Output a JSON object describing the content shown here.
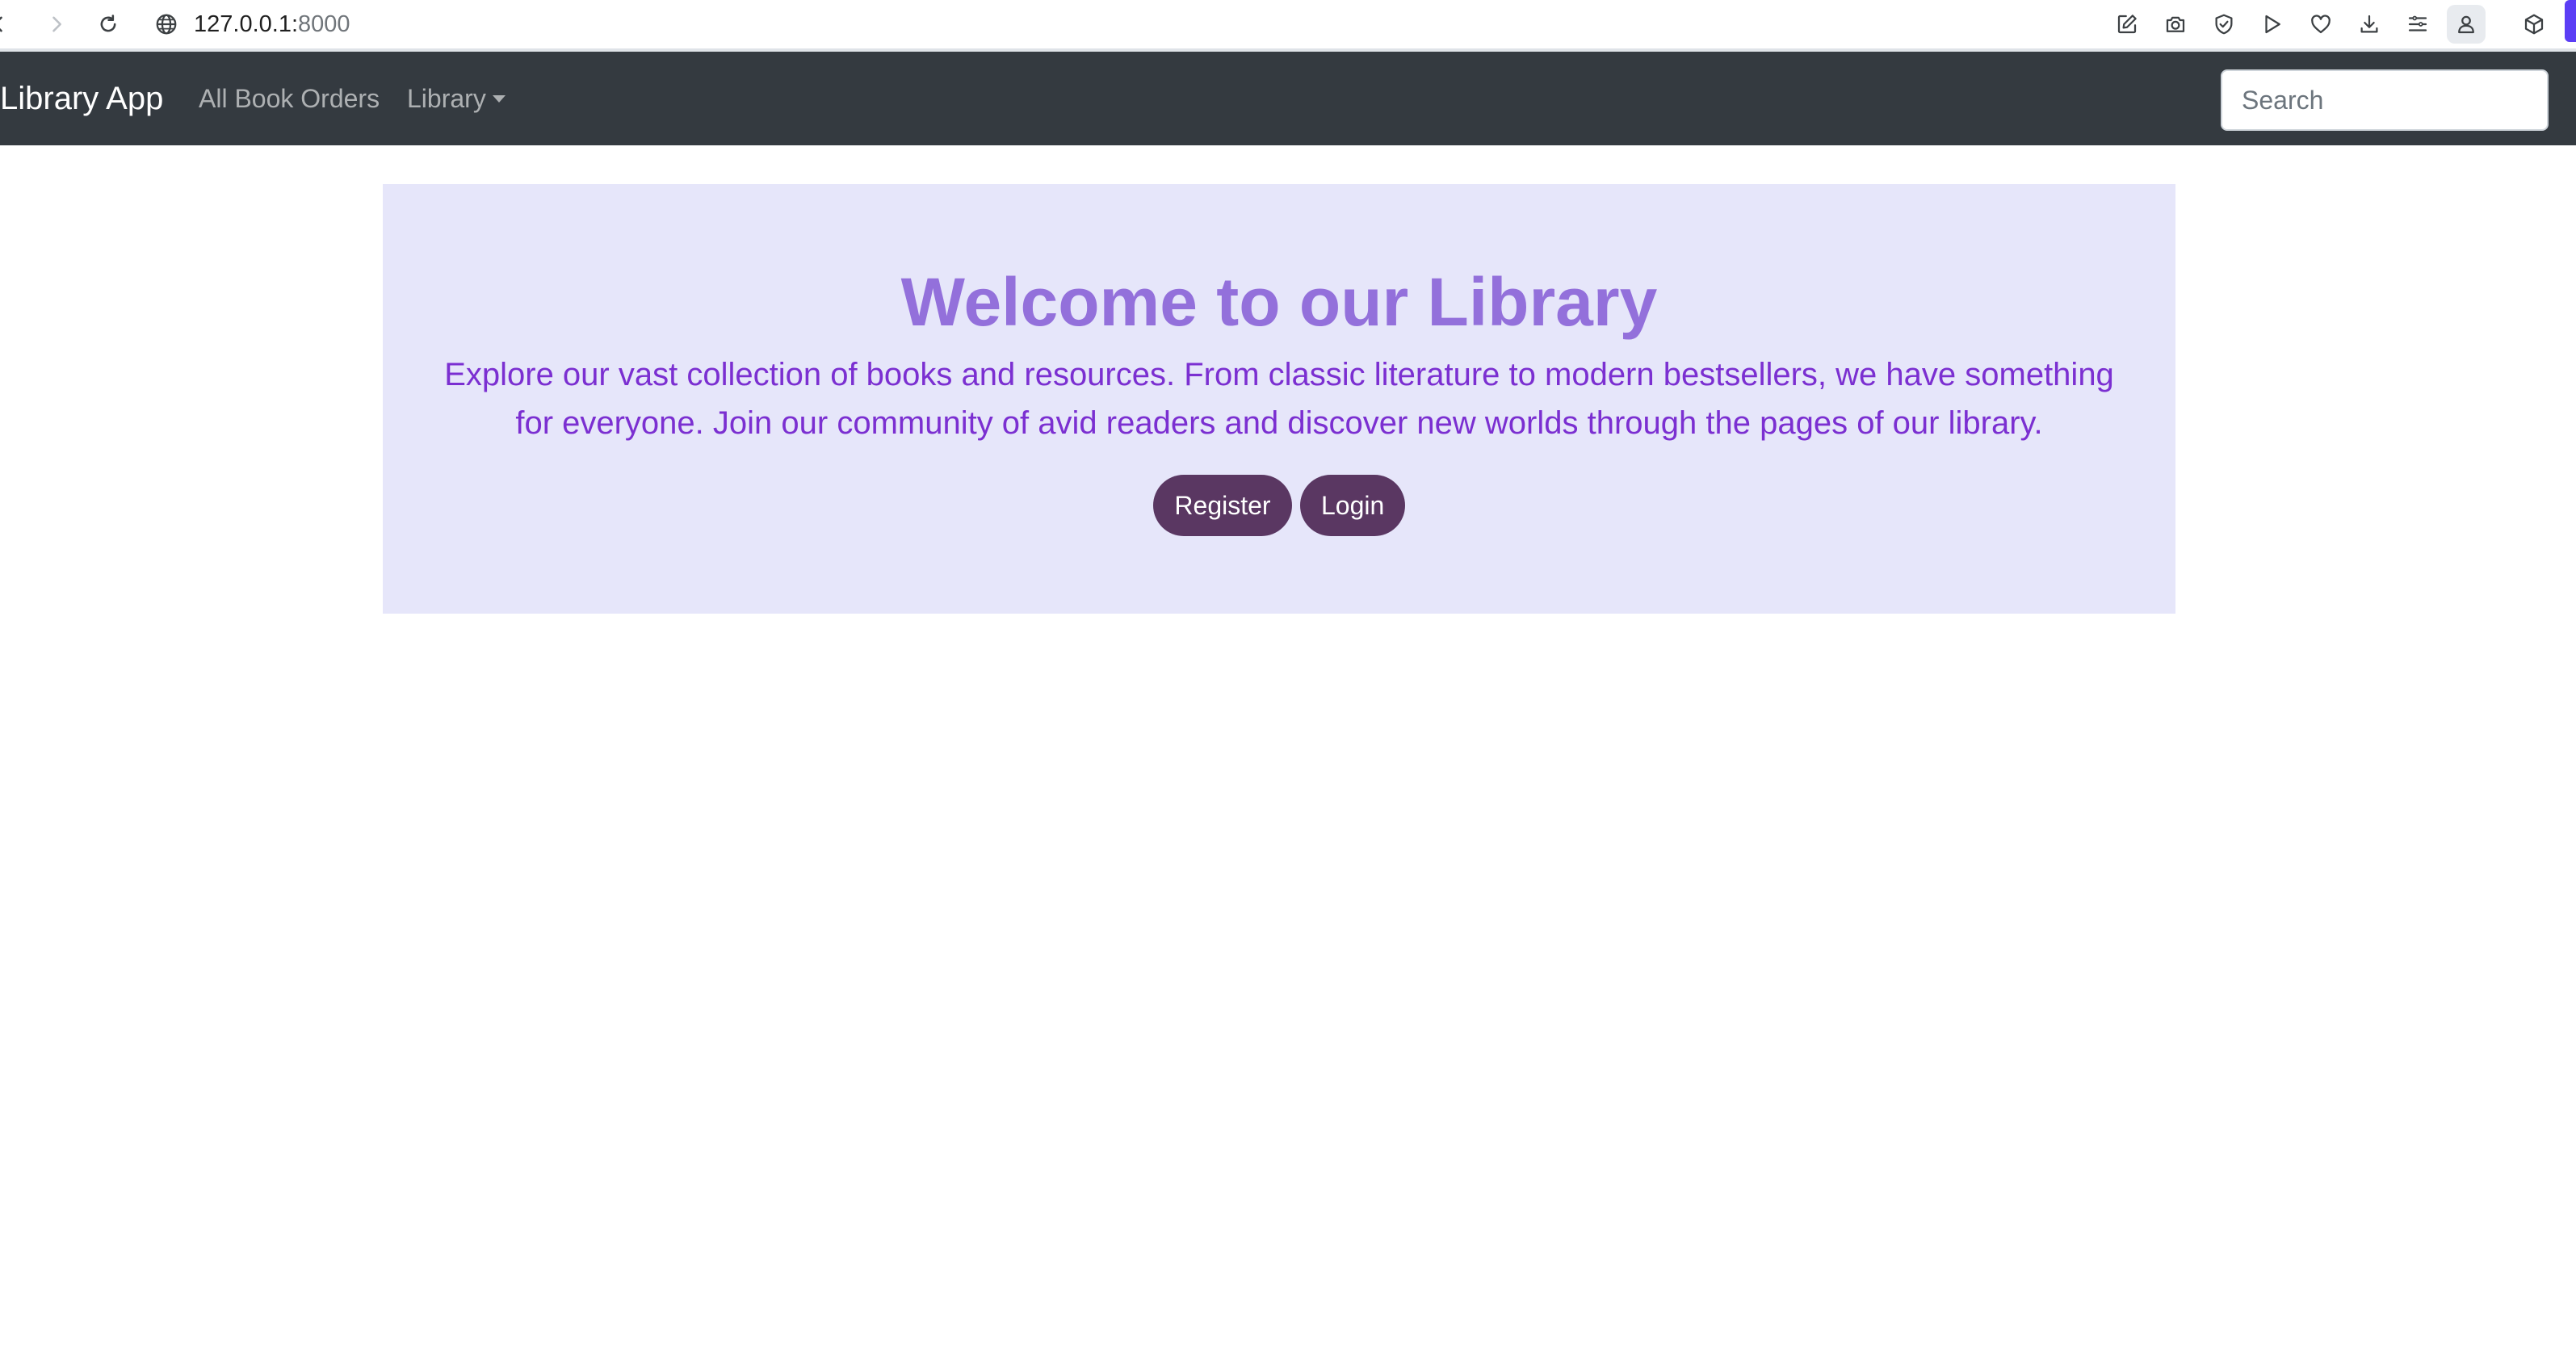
{
  "browser": {
    "url_host": "127.0.0.1:",
    "url_port": "8000",
    "icons": [
      "back-icon",
      "forward-icon",
      "reload-icon",
      "globe-icon",
      "edit-icon",
      "camera-icon",
      "shield-icon",
      "play-icon",
      "heart-icon",
      "download-icon",
      "menu-icon",
      "profile-icon",
      "cube-icon"
    ]
  },
  "navbar": {
    "brand": "Library App",
    "links": [
      {
        "label": "All Book Orders"
      },
      {
        "label": "Library"
      }
    ],
    "search_placeholder": "Search"
  },
  "hero": {
    "title": "Welcome to our Library",
    "text": "Explore our vast collection of books and resources. From classic literature to modern bestsellers, we have something for everyone. Join our community of avid readers and discover new worlds through the pages of our library.",
    "register_label": "Register",
    "login_label": "Login"
  },
  "colors": {
    "navbar_bg": "#343a40",
    "hero_bg": "#e6e6fa",
    "title_color": "#9370db",
    "text_color": "#7b2fd1",
    "button_bg": "#5a3762"
  }
}
